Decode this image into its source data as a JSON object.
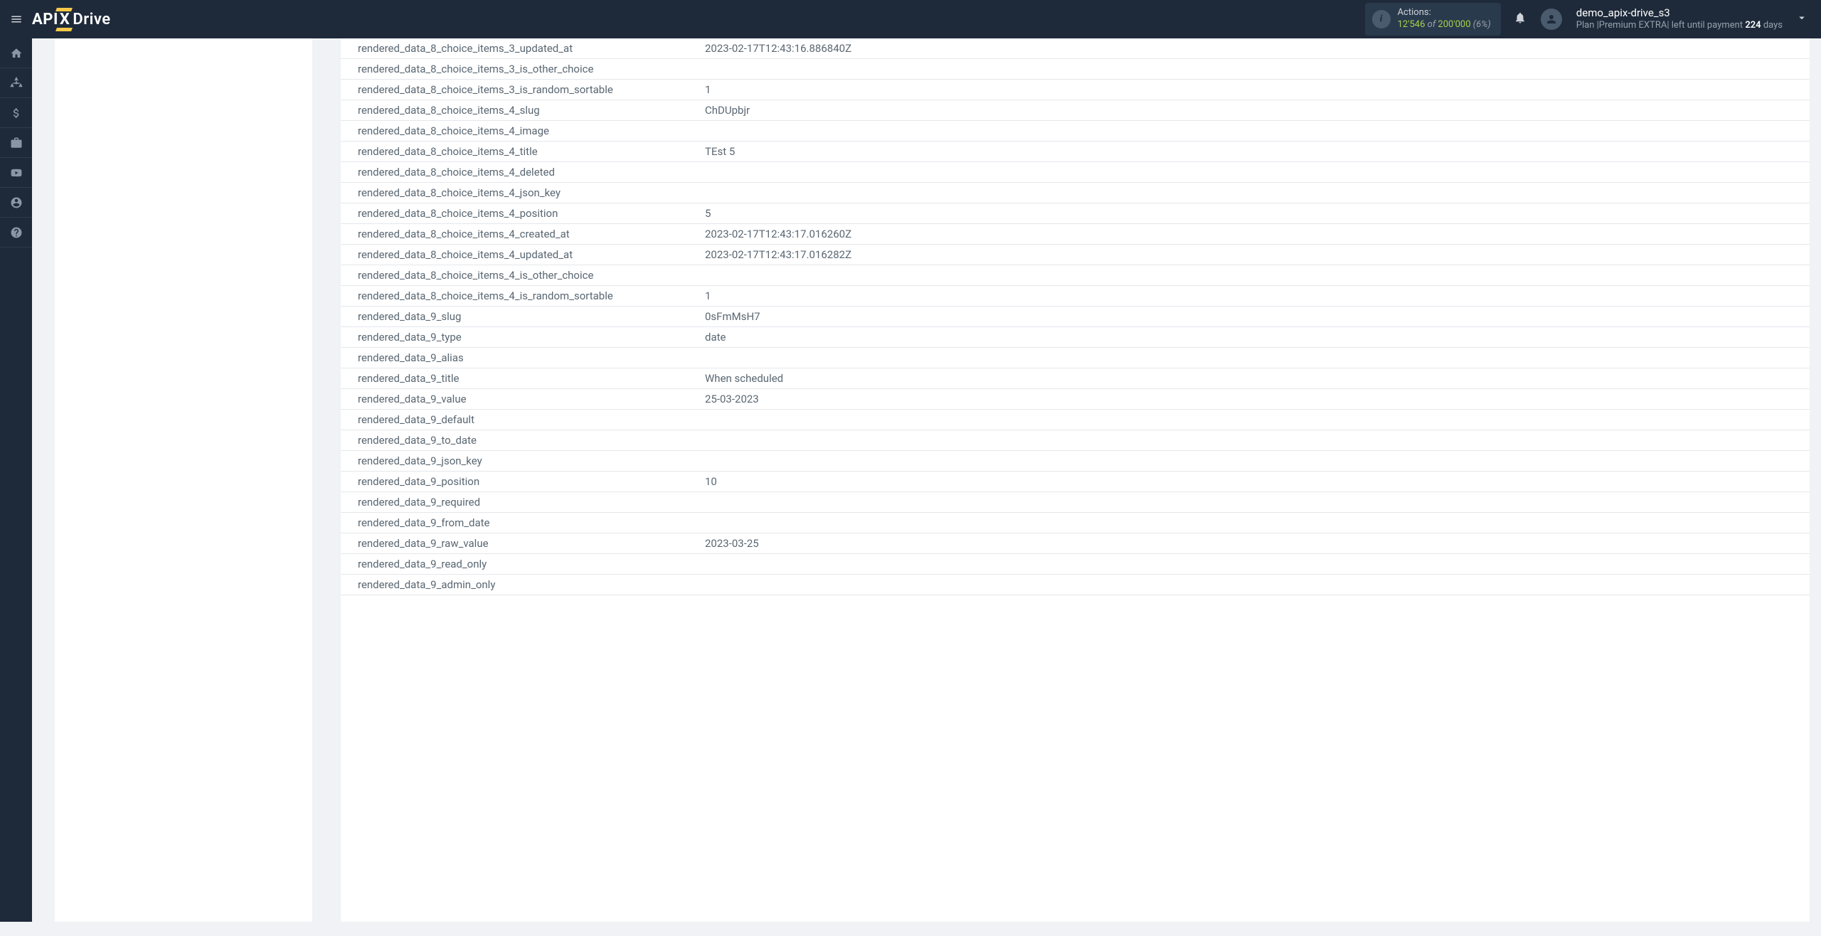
{
  "topbar": {
    "logo_api": "API",
    "logo_x": "X",
    "logo_drive": "Drive",
    "actions_label": "Actions:",
    "actions_count": "12'546",
    "actions_of": "of",
    "actions_total": "200'000",
    "actions_pct": "(6%)",
    "user_name": "demo_apix-drive_s3",
    "plan_prefix": "Plan |",
    "plan_name": "Premium EXTRA",
    "plan_mid": "| left until payment ",
    "plan_days": "224",
    "plan_suffix": " days"
  },
  "rows": [
    {
      "key": "rendered_data_8_choice_items_3_updated_at",
      "val": "2023-02-17T12:43:16.886840Z"
    },
    {
      "key": "rendered_data_8_choice_items_3_is_other_choice",
      "val": ""
    },
    {
      "key": "rendered_data_8_choice_items_3_is_random_sortable",
      "val": "1"
    },
    {
      "key": "rendered_data_8_choice_items_4_slug",
      "val": "ChDUpbjr"
    },
    {
      "key": "rendered_data_8_choice_items_4_image",
      "val": ""
    },
    {
      "key": "rendered_data_8_choice_items_4_title",
      "val": "TEst 5"
    },
    {
      "key": "rendered_data_8_choice_items_4_deleted",
      "val": ""
    },
    {
      "key": "rendered_data_8_choice_items_4_json_key",
      "val": ""
    },
    {
      "key": "rendered_data_8_choice_items_4_position",
      "val": "5"
    },
    {
      "key": "rendered_data_8_choice_items_4_created_at",
      "val": "2023-02-17T12:43:17.016260Z"
    },
    {
      "key": "rendered_data_8_choice_items_4_updated_at",
      "val": "2023-02-17T12:43:17.016282Z"
    },
    {
      "key": "rendered_data_8_choice_items_4_is_other_choice",
      "val": ""
    },
    {
      "key": "rendered_data_8_choice_items_4_is_random_sortable",
      "val": "1"
    },
    {
      "key": "rendered_data_9_slug",
      "val": "0sFmMsH7"
    },
    {
      "key": "rendered_data_9_type",
      "val": "date"
    },
    {
      "key": "rendered_data_9_alias",
      "val": ""
    },
    {
      "key": "rendered_data_9_title",
      "val": "When scheduled"
    },
    {
      "key": "rendered_data_9_value",
      "val": "25-03-2023"
    },
    {
      "key": "rendered_data_9_default",
      "val": ""
    },
    {
      "key": "rendered_data_9_to_date",
      "val": ""
    },
    {
      "key": "rendered_data_9_json_key",
      "val": ""
    },
    {
      "key": "rendered_data_9_position",
      "val": "10"
    },
    {
      "key": "rendered_data_9_required",
      "val": ""
    },
    {
      "key": "rendered_data_9_from_date",
      "val": ""
    },
    {
      "key": "rendered_data_9_raw_value",
      "val": "2023-03-25"
    },
    {
      "key": "rendered_data_9_read_only",
      "val": ""
    },
    {
      "key": "rendered_data_9_admin_only",
      "val": ""
    }
  ]
}
